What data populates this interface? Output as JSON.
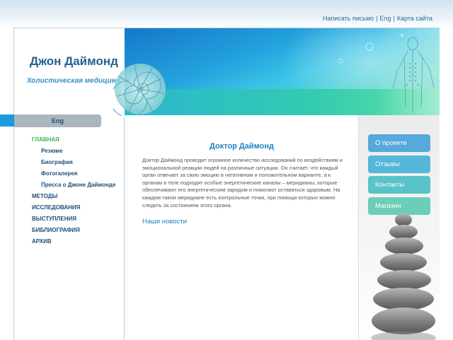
{
  "header": {
    "links": [
      "Написать письмо",
      "Eng",
      "Карта сайта"
    ],
    "separator": "|"
  },
  "site": {
    "title": "Джон Даймонд",
    "subtitle": "Холистическая медицина"
  },
  "lang_button": "Eng",
  "nav": {
    "items": [
      {
        "label": "ГЛАВНАЯ",
        "active": true
      },
      {
        "label": "Резюме",
        "sub": true
      },
      {
        "label": "Биография",
        "sub": true
      },
      {
        "label": "Фотогалерея",
        "sub": true
      },
      {
        "label": "Пресса о Джоне Даймонде",
        "sub": true
      },
      {
        "label": "МЕТОДЫ"
      },
      {
        "label": "ИССЛЕДОВАНИЯ"
      },
      {
        "label": "ВЫСТУПЛЕНИЯ"
      },
      {
        "label": "БИБЛИОГРАФИЯ"
      },
      {
        "label": "АРХИВ"
      }
    ]
  },
  "main": {
    "title": "Доктор Даймонд",
    "text": "Доктор Даймонд проводит огромное количество исследований по воздействиям и эмоциональной реакции людей на различные ситуации. Он считает, что каждый орган отвечает за свою эмоцию в негативном и положительном варианте, а к органам в теле подходят особые энергетические каналы – меридианы, которые обеспечивают его энергетическим зарядом и помогают оставаться здоровым. На каждом таком меридиане есть контрольные точки, при помощи которых можно следить за состоянием этого органа.",
    "news_link": "Наши новости"
  },
  "right_menu": [
    {
      "label": "О проекте",
      "color": "#56a9dc"
    },
    {
      "label": "Отзывы",
      "color": "#55b7d9"
    },
    {
      "label": "Контакты",
      "color": "#58c3c8"
    },
    {
      "label": "Магазин",
      "color": "#6ccdb9"
    }
  ],
  "colors": {
    "accent": "#1c82c4",
    "nav_text": "#1f4f78",
    "active": "#3bb34a"
  }
}
